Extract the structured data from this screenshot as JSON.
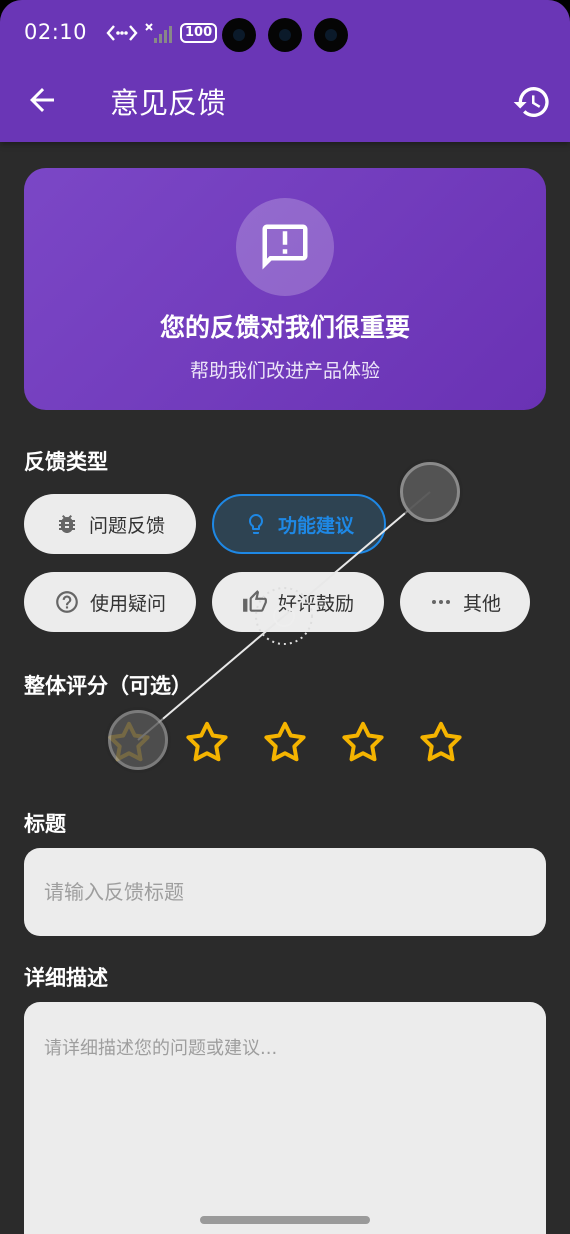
{
  "status_bar": {
    "time": "02:10",
    "battery": "100"
  },
  "app_bar": {
    "title": "意见反馈"
  },
  "hero": {
    "title": "您的反馈对我们很重要",
    "subtitle": "帮助我们改进产品体验"
  },
  "feedback_type": {
    "label": "反馈类型",
    "options": [
      {
        "label": "问题反馈",
        "icon": "bug-icon",
        "selected": false
      },
      {
        "label": "功能建议",
        "icon": "lightbulb-icon",
        "selected": true
      },
      {
        "label": "使用疑问",
        "icon": "help-circle-icon",
        "selected": false
      },
      {
        "label": "好评鼓励",
        "icon": "thumb-up-icon",
        "selected": false
      },
      {
        "label": "其他",
        "icon": "more-horiz-icon",
        "selected": false
      }
    ]
  },
  "rating": {
    "label": "整体评分（可选）",
    "max": 5,
    "value": 0,
    "star_color": "#f5b400"
  },
  "title_field": {
    "label": "标题",
    "placeholder": "请输入反馈标题",
    "value": ""
  },
  "description_field": {
    "label": "详细描述",
    "placeholder": "请详细描述您的问题或建议...",
    "value": ""
  },
  "colors": {
    "app_bar": "#6a36b6",
    "accent": "#1e88e5",
    "background": "#2b2b2b"
  }
}
